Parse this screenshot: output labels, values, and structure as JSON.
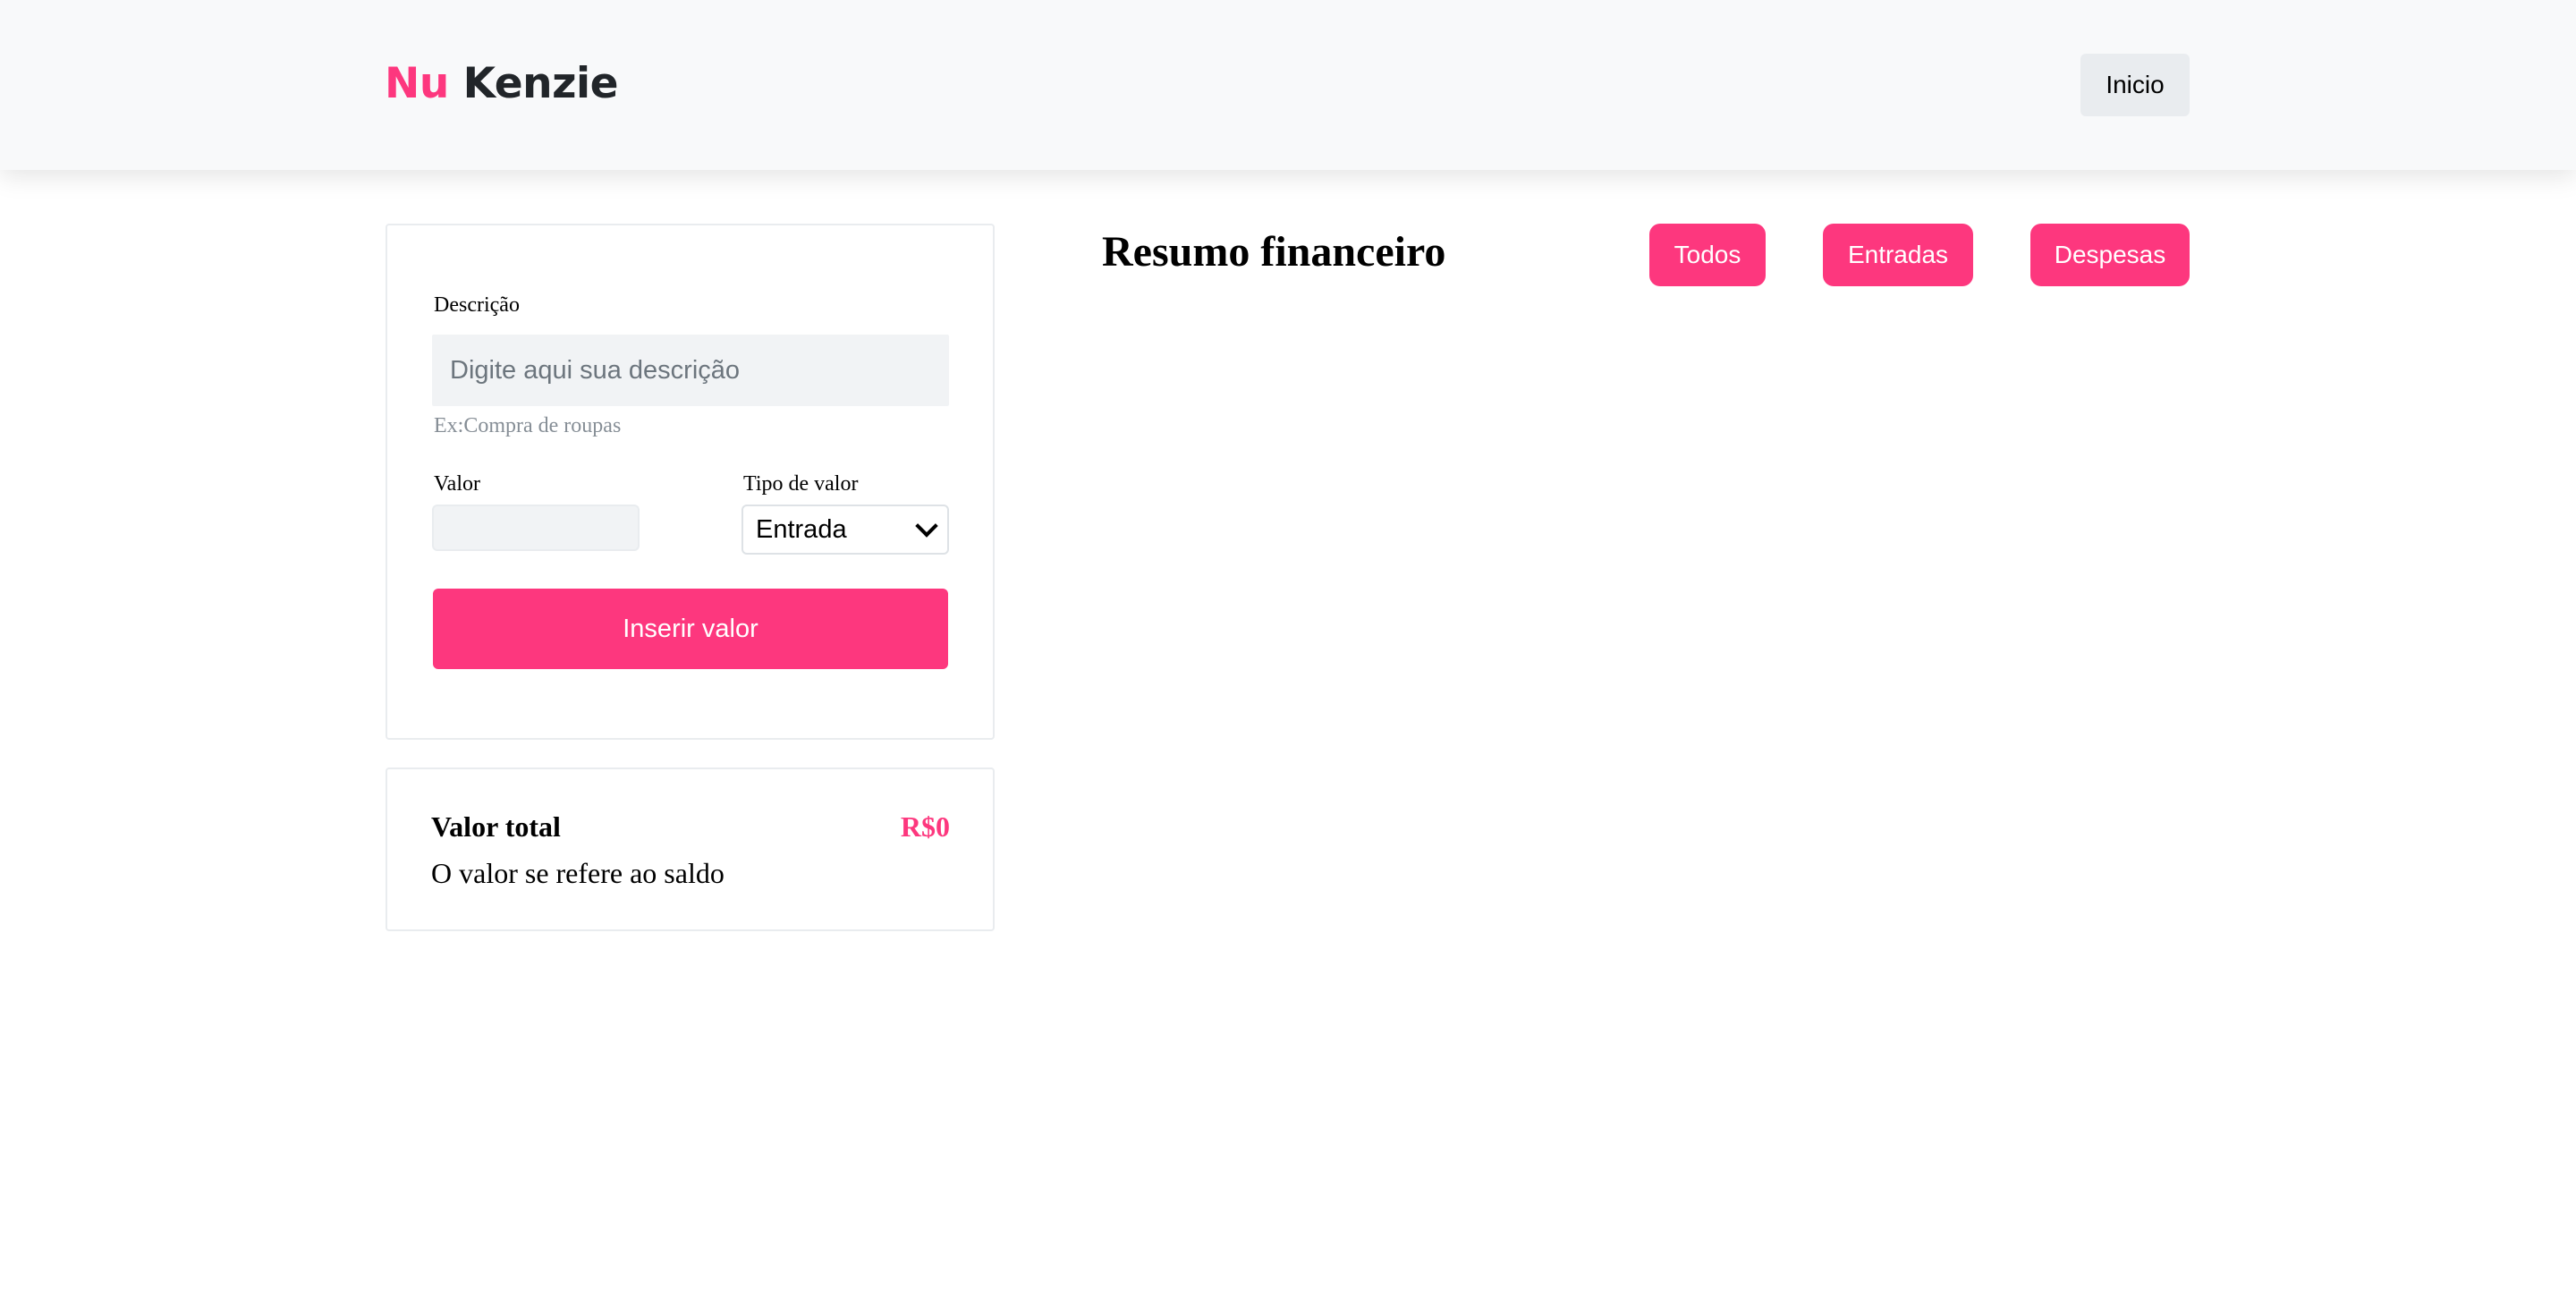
{
  "header": {
    "logo_part1": "Nu",
    "logo_part2": "Kenzie",
    "home_button": "Inicio"
  },
  "form": {
    "description_label": "Descrição",
    "description_placeholder": "Digite aqui sua descrição",
    "description_value": "",
    "description_hint": "Ex:Compra de roupas",
    "value_label": "Valor",
    "value_value": "",
    "type_label": "Tipo de valor",
    "type_selected": "Entrada",
    "submit_button": "Inserir valor"
  },
  "total": {
    "title": "Valor total",
    "amount": "R$0",
    "subtitle": "O valor se refere ao saldo"
  },
  "summary": {
    "title": "Resumo financeiro",
    "filters": [
      "Todos",
      "Entradas",
      "Despesas"
    ]
  },
  "colors": {
    "accent": "#fd377e",
    "header_bg": "#f8f9fa",
    "text": "#212529"
  }
}
